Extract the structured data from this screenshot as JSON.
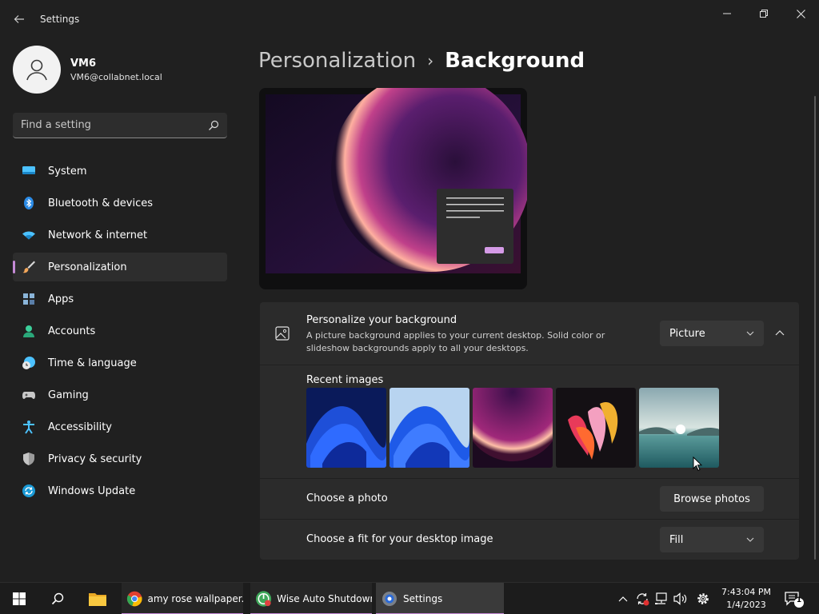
{
  "window": {
    "title": "Settings"
  },
  "profile": {
    "name": "VM6",
    "email": "VM6@collabnet.local"
  },
  "search": {
    "placeholder": "Find a setting"
  },
  "sidebar": {
    "items": [
      {
        "label": "System",
        "icon": "monitor-icon"
      },
      {
        "label": "Bluetooth & devices",
        "icon": "bluetooth-icon"
      },
      {
        "label": "Network & internet",
        "icon": "wifi-icon"
      },
      {
        "label": "Personalization",
        "icon": "brush-icon",
        "active": true
      },
      {
        "label": "Apps",
        "icon": "apps-icon"
      },
      {
        "label": "Accounts",
        "icon": "person-icon"
      },
      {
        "label": "Time & language",
        "icon": "clock-globe-icon"
      },
      {
        "label": "Gaming",
        "icon": "gamepad-icon"
      },
      {
        "label": "Accessibility",
        "icon": "accessibility-icon"
      },
      {
        "label": "Privacy & security",
        "icon": "shield-icon"
      },
      {
        "label": "Windows Update",
        "icon": "update-icon"
      }
    ]
  },
  "breadcrumb": {
    "parent": "Personalization",
    "separator": "›",
    "current": "Background"
  },
  "personalize": {
    "title": "Personalize your background",
    "description": "A picture background applies to your current desktop. Solid color or slideshow backgrounds apply to all your desktops.",
    "selected": "Picture"
  },
  "recent": {
    "label": "Recent images",
    "images": [
      "bloom-dark-blue",
      "bloom-light-blue",
      "glow-purple",
      "ribbon-colorful",
      "lake-landscape"
    ]
  },
  "choose_photo": {
    "label": "Choose a photo",
    "button": "Browse photos"
  },
  "fit": {
    "label": "Choose a fit for your desktop image",
    "selected": "Fill"
  },
  "taskbar": {
    "apps": [
      {
        "label": "amy rose wallpaper...",
        "icon": "chrome-icon"
      },
      {
        "label": "Wise Auto Shutdown",
        "icon": "wise-shutdown-icon"
      },
      {
        "label": "Settings",
        "icon": "settings-icon",
        "active": true
      }
    ],
    "time": "7:43:04 PM",
    "date": "1/4/2023",
    "notification_count": "1"
  },
  "colors": {
    "accent": "#c58ad6",
    "background": "#202020",
    "card": "#2b2b2b"
  }
}
